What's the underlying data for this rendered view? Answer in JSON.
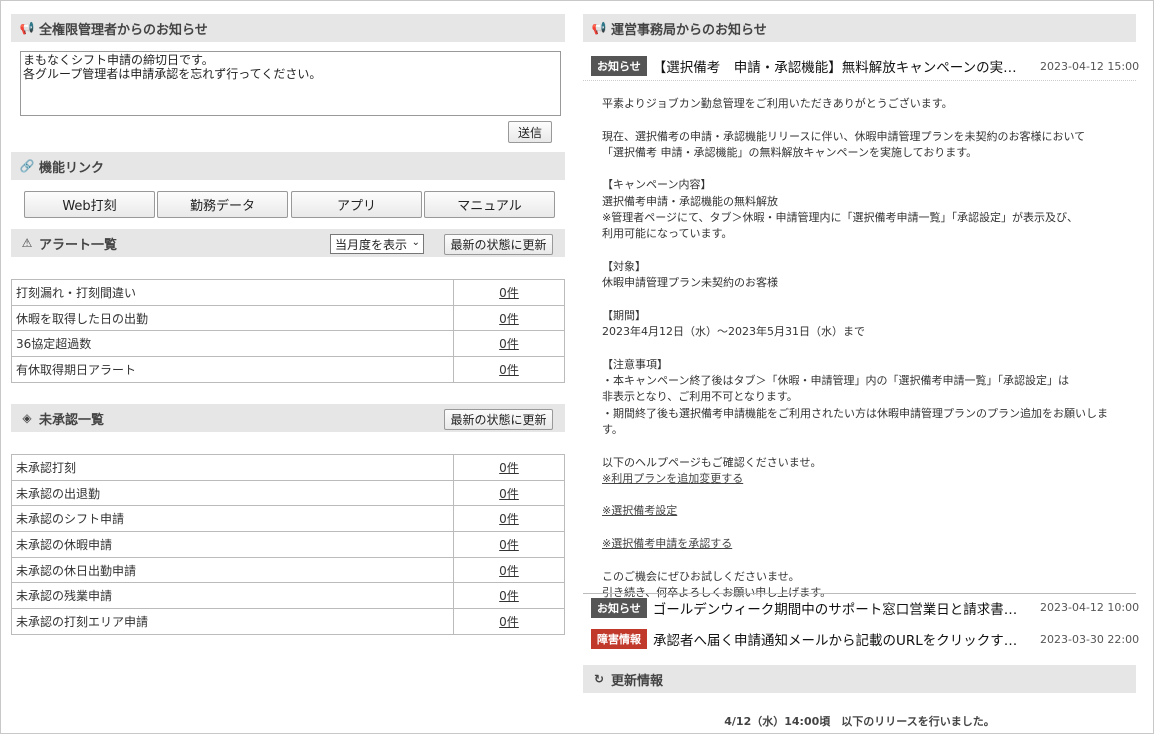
{
  "admin_notice": {
    "title": "全権限管理者からのお知らせ",
    "message": "まもなくシフト申請の締切日です。\n各グループ管理者は申請承認を忘れず行ってください。",
    "send_label": "送信"
  },
  "links": {
    "title": "機能リンク",
    "items": [
      "Web打刻",
      "勤務データ",
      "アプリ",
      "マニュアル"
    ]
  },
  "alerts": {
    "title": "アラート一覧",
    "period_select": "当月度を表示",
    "refresh_label": "最新の状態に更新",
    "rows": [
      {
        "label": "打刻漏れ・打刻間違い",
        "count": "0件"
      },
      {
        "label": "休暇を取得した日の出勤",
        "count": "0件"
      },
      {
        "label": "36協定超過数",
        "count": "0件"
      },
      {
        "label": "有休取得期日アラート",
        "count": "0件"
      }
    ]
  },
  "unapproved": {
    "title": "未承認一覧",
    "refresh_label": "最新の状態に更新",
    "rows": [
      {
        "label": "未承認打刻",
        "count": "0件"
      },
      {
        "label": "未承認の出退勤",
        "count": "0件"
      },
      {
        "label": "未承認のシフト申請",
        "count": "0件"
      },
      {
        "label": "未承認の休暇申請",
        "count": "0件"
      },
      {
        "label": "未承認の休日出勤申請",
        "count": "0件"
      },
      {
        "label": "未承認の残業申請",
        "count": "0件"
      },
      {
        "label": "未承認の打刻エリア申請",
        "count": "0件"
      }
    ]
  },
  "office_notice": {
    "title": "運営事務局からのお知らせ",
    "items": [
      {
        "badge": "お知らせ",
        "title": "【選択備考　申請・承認機能】無料解放キャンペーンの実…",
        "date": "2023-04-12 15:00"
      },
      {
        "badge": "お知らせ",
        "title": "ゴールデンウィーク期間中のサポート窓口営業日と請求書…",
        "date": "2023-04-12 10:00"
      },
      {
        "badge": "障害情報",
        "title": "承認者へ届く申請通知メールから記載のURLをクリックす…",
        "date": "2023-03-30 22:00"
      }
    ],
    "body": {
      "greeting": "平素よりジョブカン勤怠管理をご利用いただきありがとうございます。",
      "intro": "現在、選択備考の申請・承認機能リリースに伴い、休暇申請管理プランを未契約のお客様において\n「選択備考 申請・承認機能」の無料解放キャンペーンを実施しております。",
      "campaign": "【キャンペーン内容】\n選択備考申請・承認機能の無料解放\n※管理者ページにて、タブ＞休暇・申請管理内に「選択備考申請一覧」「承認設定」が表示及び、\n利用可能になっています。",
      "target": "【対象】\n休暇申請管理プラン未契約のお客様",
      "period": "【期間】\n2023年4月12日（水）～2023年5月31日（水）まで",
      "caution": "【注意事項】\n・本キャンペーン終了後はタブ＞「休暇・申請管理」内の「選択備考申請一覧」「承認設定」は\n非表示となり、ご利用不可となります。\n・期間終了後も選択備考申請機能をご利用されたい方は休暇申請管理プランのプラン追加をお願いします。",
      "help_intro": "以下のヘルプページもご確認くださいませ。",
      "help_link_1": "※利用プランを追加変更する",
      "help_link_2": "※選択備考設定",
      "help_link_3": "※選択備考申請を承認する",
      "closing": "このご機会にぜひお試しくださいませ。\n引き続き、何卒よろしくお願い申し上げます。"
    }
  },
  "updates": {
    "title": "更新情報",
    "first_line": "4/12（水）14:00頃　以下のリリースを行いました。"
  }
}
